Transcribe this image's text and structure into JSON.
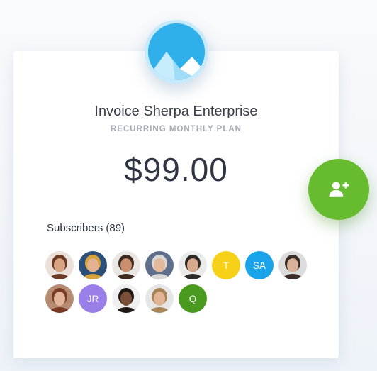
{
  "product": {
    "title": "Invoice Sherpa Enterprise",
    "plan": "RECURRING MONTHLY PLAN",
    "price": "$99.00",
    "logo_icon": "mountain-logo-icon"
  },
  "subscribers": {
    "label": "Subscribers (89)",
    "avatars": [
      {
        "type": "photo",
        "name": "avatar-photo-1",
        "tone": "#d9a483",
        "hair": "#6b3b25",
        "bg": "#eadfd9"
      },
      {
        "type": "photo",
        "name": "avatar-photo-2",
        "tone": "#e2b291",
        "hair": "#d6a33a",
        "bg": "#2c4f7a"
      },
      {
        "type": "photo",
        "name": "avatar-photo-3",
        "tone": "#c98f6e",
        "hair": "#3c2a20",
        "bg": "#e9e6e3"
      },
      {
        "type": "photo",
        "name": "avatar-photo-4",
        "tone": "#e3b99b",
        "hair": "#d8d8d8",
        "bg": "#5f6e8a"
      },
      {
        "type": "photo",
        "name": "avatar-photo-5",
        "tone": "#d7aa8f",
        "hair": "#2f2a26",
        "bg": "#ebebeb"
      },
      {
        "type": "initials",
        "text": "T",
        "color": "#f7d117"
      },
      {
        "type": "initials",
        "text": "SA",
        "color": "#1aa3e8"
      },
      {
        "type": "photo",
        "name": "avatar-photo-6",
        "tone": "#d8b39a",
        "hair": "#3a2d27",
        "bg": "#dcdcdc"
      },
      {
        "type": "photo",
        "name": "avatar-photo-7",
        "tone": "#e3b59b",
        "hair": "#7a3a23",
        "bg": "#b58b72"
      },
      {
        "type": "initials",
        "text": "JR",
        "color": "#9b7fe8"
      },
      {
        "type": "photo",
        "name": "avatar-photo-8",
        "tone": "#7a4f38",
        "hair": "#1f1713",
        "bg": "#efefef"
      },
      {
        "type": "photo",
        "name": "avatar-photo-9",
        "tone": "#e1b496",
        "hair": "#a88459",
        "bg": "#e6e6e6"
      },
      {
        "type": "initials",
        "text": "Q",
        "color": "#4a9a1f"
      }
    ]
  },
  "actions": {
    "add_subscriber_icon": "add-user-icon",
    "accent": "#66bb2e"
  }
}
